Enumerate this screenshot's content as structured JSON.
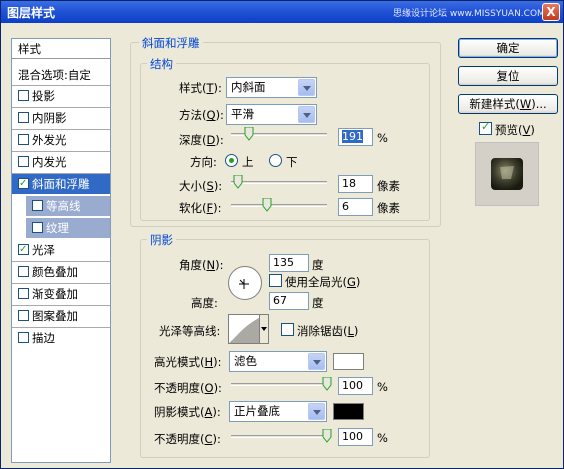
{
  "window": {
    "title": "图层样式",
    "watermark": "思缘设计论坛 www.MISSYUAN.COM",
    "close_label": "X"
  },
  "styles_list": {
    "header": "样式",
    "blend_options": "混合选项:自定",
    "items": [
      {
        "label": "投影",
        "checked": false
      },
      {
        "label": "内阴影",
        "checked": false
      },
      {
        "label": "外发光",
        "checked": false
      },
      {
        "label": "内发光",
        "checked": false
      },
      {
        "label": "斜面和浮雕",
        "checked": true,
        "selected": true
      },
      {
        "label": "等高线",
        "checked": false,
        "sub": true
      },
      {
        "label": "纹理",
        "checked": false,
        "sub": true
      },
      {
        "label": "光泽",
        "checked": true
      },
      {
        "label": "颜色叠加",
        "checked": false
      },
      {
        "label": "渐变叠加",
        "checked": false
      },
      {
        "label": "图案叠加",
        "checked": false
      },
      {
        "label": "描边",
        "checked": false
      }
    ]
  },
  "bevel": {
    "group_title": "斜面和浮雕",
    "structure_title": "结构",
    "style_label": "样式(",
    "style_key": "T",
    "style_value": "内斜面",
    "technique_label": "方法(",
    "technique_key": "Q",
    "technique_value": "平滑",
    "depth_label": "深度(",
    "depth_key": "D",
    "depth_value": "191",
    "depth_slider": 0.19,
    "depth_unit": "%",
    "direction_label": "方向:",
    "direction_up": "上",
    "direction_down": "下",
    "size_label": "大小(",
    "size_key": "S",
    "size_value": "18",
    "size_slider": 0.07,
    "size_unit": "像素",
    "soften_label": "软化(",
    "soften_key": "F",
    "soften_value": "6",
    "soften_slider": 0.38,
    "soften_unit": "像素"
  },
  "shading": {
    "group_title": "阴影",
    "angle_label": "角度(",
    "angle_key": "N",
    "angle_value": "135",
    "angle_unit": "度",
    "global_light_label": "使用全局光(",
    "global_light_key": "G",
    "altitude_label": "高度:",
    "altitude_value": "67",
    "altitude_unit": "度",
    "gloss_contour_label": "光泽等高线:",
    "antialias_label": "消除锯齿(",
    "antialias_key": "L",
    "highlight_mode_label": "高光模式(",
    "highlight_mode_key": "H",
    "highlight_mode_value": "滤色",
    "highlight_color": "#ffffff",
    "opacity1_label": "不透明度(",
    "opacity1_key": "O",
    "opacity1_value": "100",
    "opacity1_slider": 1.0,
    "shadow_mode_label": "阴影模式(",
    "shadow_mode_key": "A",
    "shadow_mode_value": "正片叠底",
    "shadow_color": "#000000",
    "opacity2_label": "不透明度(",
    "opacity2_key": "C",
    "opacity2_value": "100",
    "opacity2_slider": 1.0,
    "percent": "%"
  },
  "buttons": {
    "ok": "确定",
    "reset": "复位",
    "new_style": "新建样式(",
    "new_style_key": "W",
    "new_style_suffix": ")...",
    "preview_label": "预览(",
    "preview_key": "V"
  }
}
